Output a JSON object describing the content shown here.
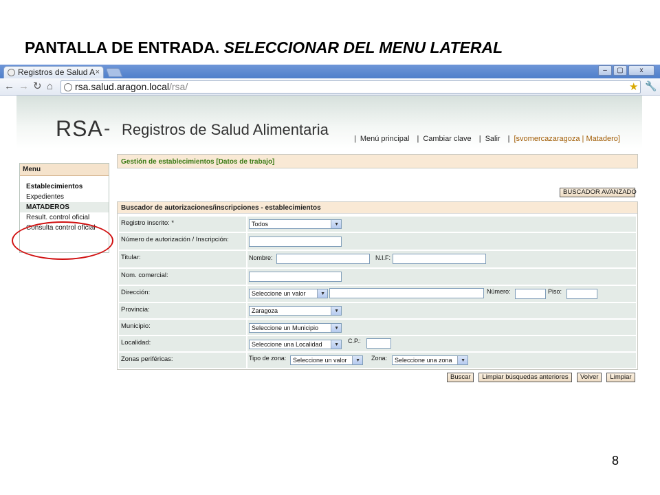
{
  "slide": {
    "title_main": "PANTALLA DE ENTRADA. ",
    "title_italic": "SELECCIONAR DEL MENU LATERAL",
    "page_number": "8"
  },
  "browser": {
    "tab_title": "Registros de Salud A",
    "tab_close": "×",
    "window_buttons": {
      "minimize": "–",
      "restore": "▢",
      "close": "x"
    },
    "url_host": "rsa.salud.aragon.local",
    "url_path": "/rsa/"
  },
  "banner": {
    "logo_rsa": "RSA",
    "logo_dash": "-",
    "app_name": "Registros de Salud Alimentaria"
  },
  "topnav": {
    "menu_principal": "Menú principal",
    "cambiar_clave": "Cambiar clave",
    "salir": "Salir",
    "user": "[svomercazaragoza | Matadero]"
  },
  "sidemenu": {
    "header": "Menu",
    "items": [
      {
        "label": "Establecimientos",
        "bold": true
      },
      {
        "label": "Expedientes",
        "bold": false
      },
      {
        "label": "MATADEROS",
        "bold": true
      },
      {
        "label": "Result. control oficial",
        "bold": false
      },
      {
        "label": "Consulta control oficial",
        "bold": false
      }
    ]
  },
  "main": {
    "section_title": "Gestión de establecimientos [Datos de trabajo]",
    "advanced_search_button": "BUSCADOR AVANZADO",
    "form_title": "Buscador de autorizaciones/inscripciones - establecimientos"
  },
  "form": {
    "registro": {
      "label": "Registro inscrito: *",
      "value": "Todos"
    },
    "numero_autorizacion": {
      "label": "Número de autorización / Inscripción:"
    },
    "titular": {
      "label": "Titular:",
      "nombre_label": "Nombre:",
      "nif_label": "N.I.F:"
    },
    "nom_comercial": {
      "label": "Nom. comercial:"
    },
    "direccion": {
      "label": "Dirección:",
      "select_value": "Seleccione un valor",
      "numero_label": "Número:",
      "piso_label": "Piso:"
    },
    "provincia": {
      "label": "Provincia:",
      "value": "Zaragoza"
    },
    "municipio": {
      "label": "Municipio:",
      "value": "Seleccione un Municipio"
    },
    "localidad": {
      "label": "Localidad:",
      "value": "Seleccione una Localidad",
      "cp_label": "C.P.:"
    },
    "zonas": {
      "label": "Zonas periféricas:",
      "tipo_label": "Tipo de zona:",
      "tipo_value": "Seleccione un valor",
      "zona_label": "Zona:",
      "zona_value": "Seleccione una zona"
    }
  },
  "buttons": {
    "buscar": "Buscar",
    "limpiar_busquedas": "Limpiar búsquedas anteriores",
    "volver": "Volver",
    "limpiar": "Limpiar"
  }
}
